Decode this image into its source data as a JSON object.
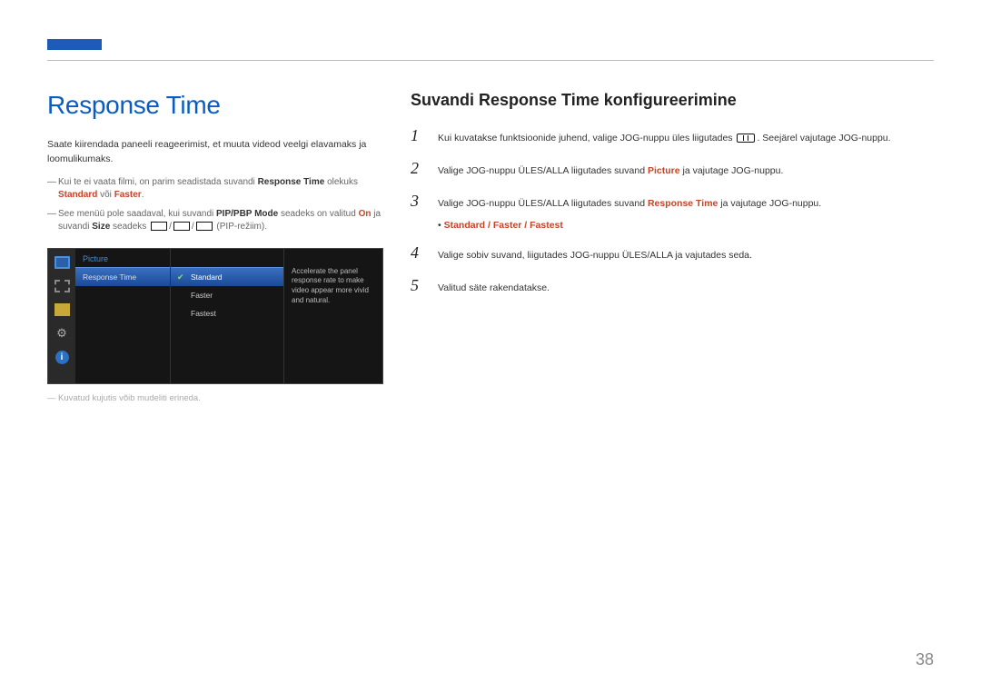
{
  "page_number": "38",
  "left": {
    "title": "Response Time",
    "intro": "Saate kiirendada paneeli reageerimist, et muuta videod veelgi elavamaks ja loomulikumaks.",
    "note1_a": "Kui te ei vaata filmi, on parim seadistada suvandi ",
    "note1_b": "Response Time",
    "note1_c": " olekuks ",
    "note1_d": "Standard",
    "note1_e": " või ",
    "note1_f": "Faster",
    "note1_g": ".",
    "note2_a": "See menüü pole saadaval, kui suvandi ",
    "note2_b": "PIP/PBP Mode",
    "note2_c": " seadeks on valitud ",
    "note2_d": "On",
    "note2_e": " ja suvandi ",
    "note2_f": "Size",
    "note2_g": " seadeks ",
    "note2_h": " (PIP-režiim).",
    "footnote": "Kuvatud kujutis võib mudeliti erineda."
  },
  "osd": {
    "section": "Picture",
    "menu_item": "Response Time",
    "opt1": "Standard",
    "opt2": "Faster",
    "opt3": "Fastest",
    "desc": "Accelerate the panel response rate to make video appear more vivid and natural.",
    "icons": {
      "info": "i"
    }
  },
  "right": {
    "subtitle": "Suvandi Response Time konfigureerimine",
    "step1_a": "Kui kuvatakse funktsioonide juhend, valige JOG-nuppu üles liigutades ",
    "step1_b": ". Seejärel vajutage JOG-nuppu.",
    "step2_a": "Valige JOG-nuppu ÜLES/ALLA liigutades suvand ",
    "step2_b": "Picture",
    "step2_c": " ja vajutage JOG-nuppu.",
    "step3_a": "Valige JOG-nuppu ÜLES/ALLA liigutades suvand ",
    "step3_b": "Response Time",
    "step3_c": " ja vajutage JOG-nuppu.",
    "options": "Standard / Faster / Fastest",
    "step4": "Valige sobiv suvand, liigutades JOG-nuppu ÜLES/ALLA ja vajutades seda.",
    "step5": "Valitud säte rakendatakse.",
    "nums": {
      "n1": "1",
      "n2": "2",
      "n3": "3",
      "n4": "4",
      "n5": "5"
    }
  }
}
